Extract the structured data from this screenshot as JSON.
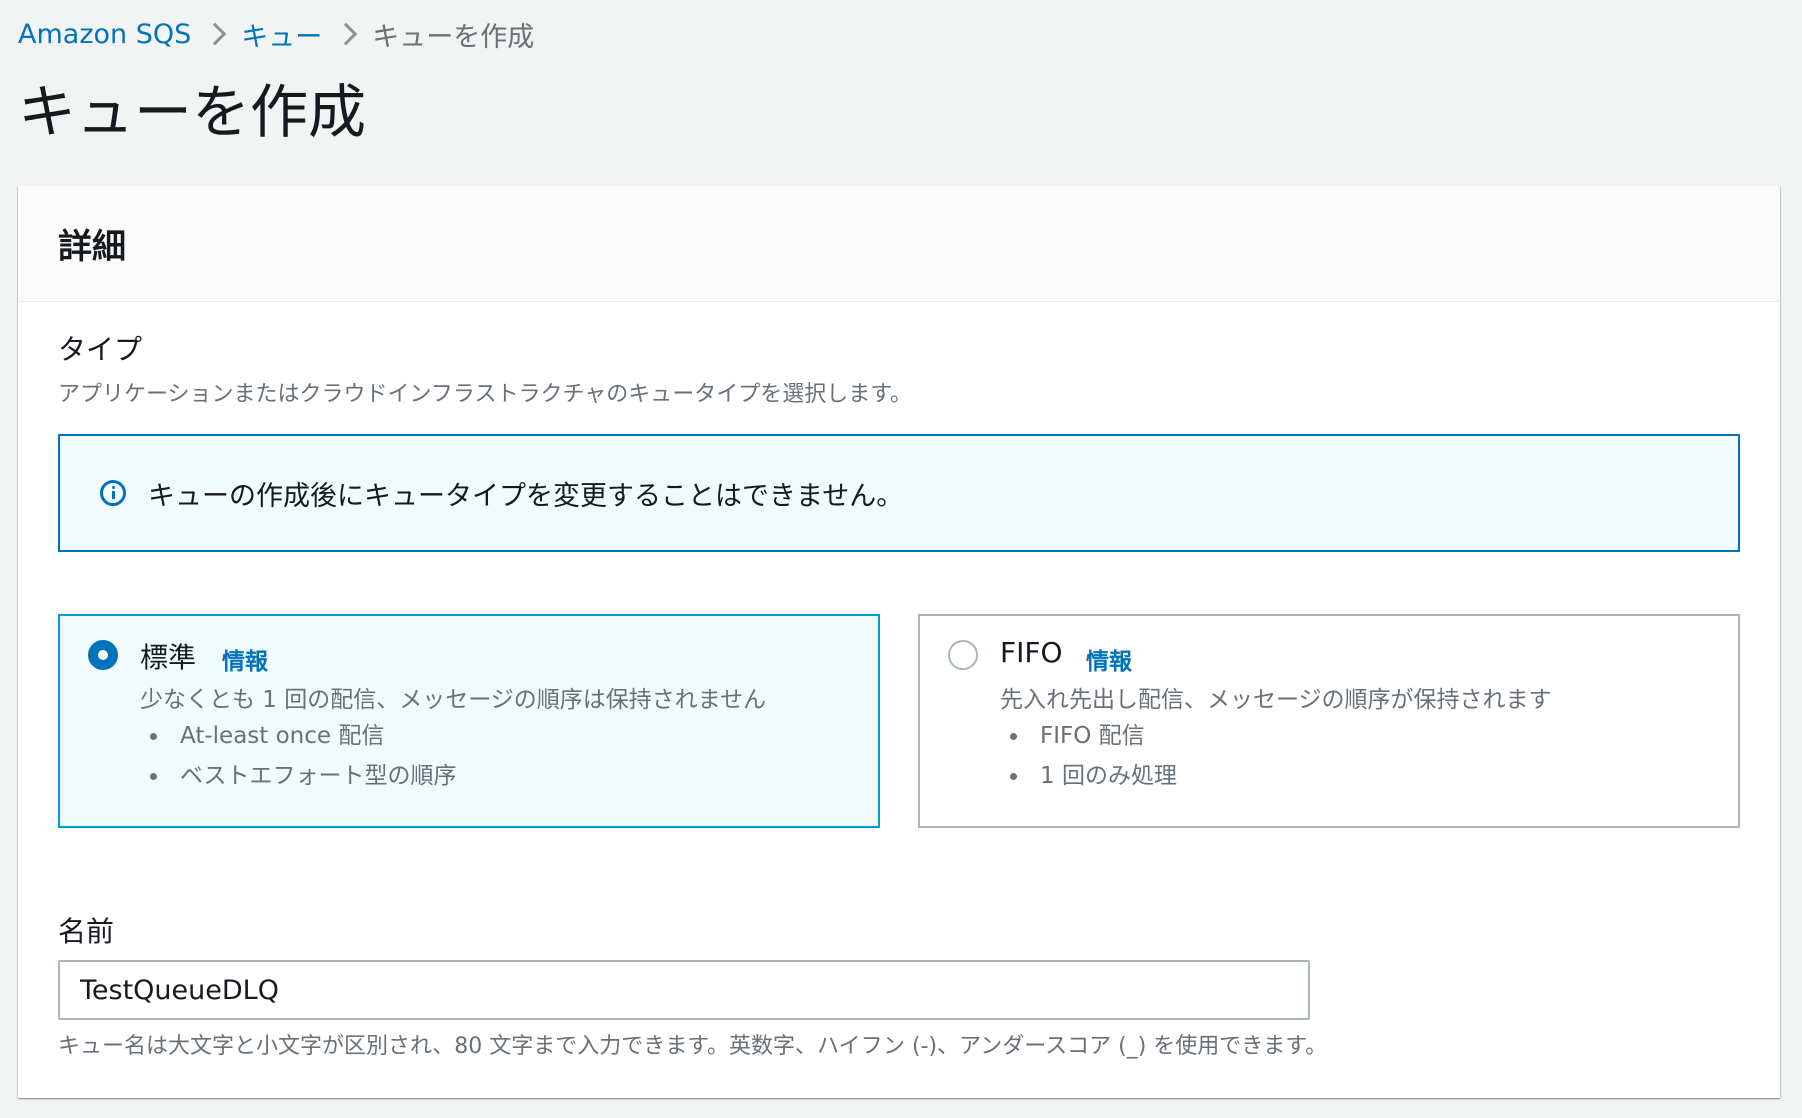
{
  "breadcrumb": {
    "items": [
      "Amazon SQS",
      "キュー"
    ],
    "current": "キューを作成"
  },
  "page_title": "キューを作成",
  "details": {
    "header": "詳細",
    "type_label": "タイプ",
    "type_description": "アプリケーションまたはクラウドインフラストラクチャのキュータイプを選択します。",
    "alert_text": "キューの作成後にキュータイプを変更することはできません。",
    "options": [
      {
        "title": "標準",
        "info": "情報",
        "selected": true,
        "description": "少なくとも 1 回の配信、メッセージの順序は保持されません",
        "bullets": [
          "At-least once 配信",
          "ベストエフォート型の順序"
        ]
      },
      {
        "title": "FIFO",
        "info": "情報",
        "selected": false,
        "description": "先入れ先出し配信、メッセージの順序が保持されます",
        "bullets": [
          "FIFO 配信",
          "1 回のみ処理"
        ]
      }
    ],
    "name_label": "名前",
    "name_value": "TestQueueDLQ",
    "name_hint": "キュー名は大文字と小文字が区別され、80 文字まで入力できます。英数字、ハイフン (-)、アンダースコア (_) を使用できます。"
  },
  "colors": {
    "link": "#0073bb",
    "selected_border": "#00a1c9",
    "selected_bg": "#f1faff",
    "page_bg": "#f2f3f3"
  }
}
